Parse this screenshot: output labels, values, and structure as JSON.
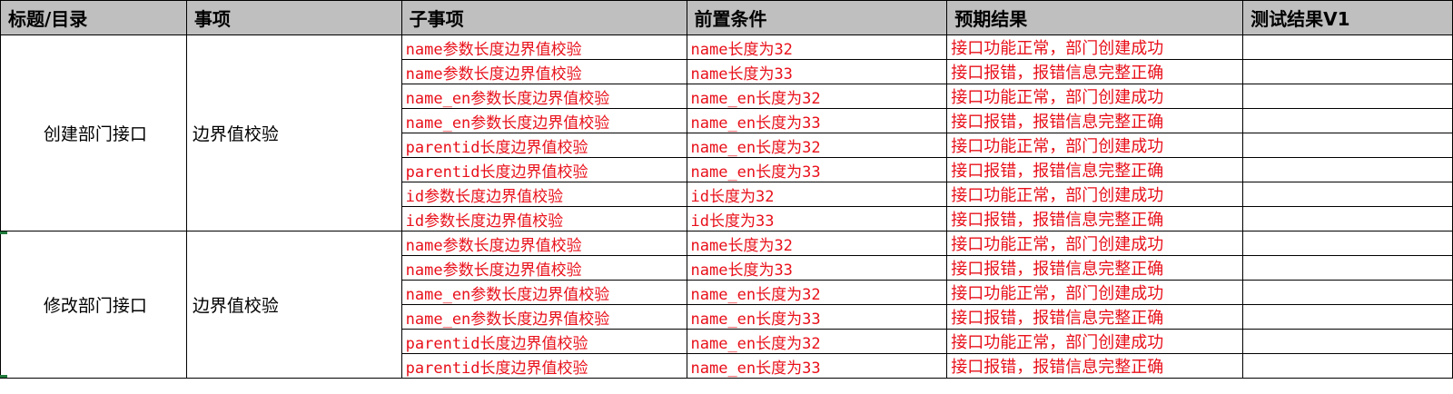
{
  "headers": [
    "标题/目录",
    "事项",
    "子事项",
    "前置条件",
    "预期结果",
    "测试结果V1"
  ],
  "groups": [
    {
      "title": "创建部门接口",
      "item": "边界值校验",
      "rows": [
        {
          "sub": "name参数长度边界值校验",
          "pre": "name长度为32",
          "expected": "接口功能正常，部门创建成功",
          "result": ""
        },
        {
          "sub": "name参数长度边界值校验",
          "pre": "name长度为33",
          "expected": "接口报错，报错信息完整正确",
          "result": ""
        },
        {
          "sub": "name_en参数长度边界值校验",
          "pre": "name_en长度为32",
          "expected": "接口功能正常，部门创建成功",
          "result": ""
        },
        {
          "sub": "name_en参数长度边界值校验",
          "pre": "name_en长度为33",
          "expected": "接口报错，报错信息完整正确",
          "result": ""
        },
        {
          "sub": "parentid长度边界值校验",
          "pre": "name_en长度为32",
          "expected": "接口功能正常，部门创建成功",
          "result": ""
        },
        {
          "sub": "parentid长度边界值校验",
          "pre": "name_en长度为33",
          "expected": "接口报错，报错信息完整正确",
          "result": ""
        },
        {
          "sub": "id参数长度边界值校验",
          "pre": "id长度为32",
          "expected": "接口功能正常，部门创建成功",
          "result": ""
        },
        {
          "sub": "id参数长度边界值校验",
          "pre": "id长度为33",
          "expected": "接口报错，报错信息完整正确",
          "result": ""
        }
      ]
    },
    {
      "title": "修改部门接口",
      "item": "边界值校验",
      "rows": [
        {
          "sub": "name参数长度边界值校验",
          "pre": "name长度为32",
          "expected": "接口功能正常，部门创建成功",
          "result": ""
        },
        {
          "sub": "name参数长度边界值校验",
          "pre": "name长度为33",
          "expected": "接口报错，报错信息完整正确",
          "result": ""
        },
        {
          "sub": "name_en参数长度边界值校验",
          "pre": "name_en长度为32",
          "expected": "接口功能正常，部门创建成功",
          "result": ""
        },
        {
          "sub": "name_en参数长度边界值校验",
          "pre": "name_en长度为33",
          "expected": "接口报错，报错信息完整正确",
          "result": ""
        },
        {
          "sub": "parentid长度边界值校验",
          "pre": "name_en长度为32",
          "expected": "接口功能正常，部门创建成功",
          "result": ""
        },
        {
          "sub": "parentid长度边界值校验",
          "pre": "name_en长度为33",
          "expected": "接口报错，报错信息完整正确",
          "result": ""
        }
      ]
    }
  ],
  "colors": {
    "header_bg": "#bfbfbf",
    "text_red": "#e8101a",
    "selection_green": "#1f7a3a"
  }
}
